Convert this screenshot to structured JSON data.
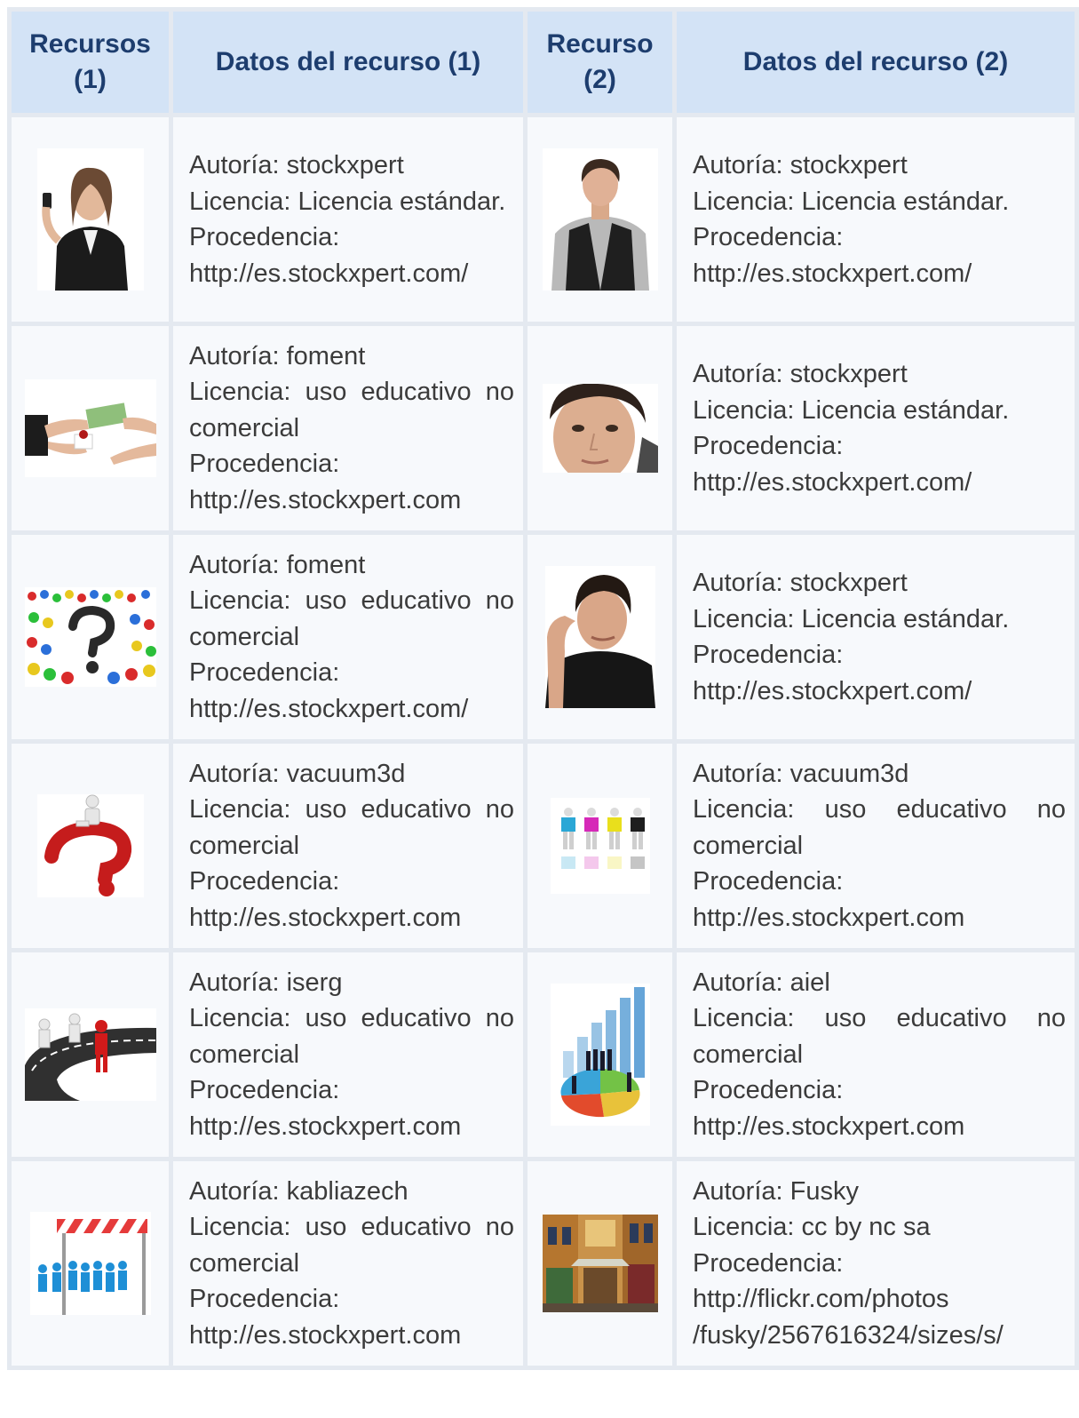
{
  "table": {
    "headers": [
      "Recursos (1)",
      "Datos del recurso (1)",
      "Recurso (2)",
      "Datos del recurso (2)"
    ],
    "rows": [
      {
        "left": {
          "image": "woman-phone-icon",
          "lines": [
            "Autoría: stockxpert",
            "Licencia: Licencia estándar.",
            "Procedencia:",
            "http://es.stockxpert.com/"
          ]
        },
        "right": {
          "image": "young-man-vest-icon",
          "lines": [
            "Autoría: stockxpert",
            "Licencia: Licencia estándar.",
            "Procedencia:",
            "http://es.stockxpert.com/"
          ]
        }
      },
      {
        "left": {
          "image": "handshake-money-icon",
          "lines": [
            "Autoría: foment",
            "Licencia: uso educativo no comercial",
            "Procedencia:",
            "http://es.stockxpert.com"
          ]
        },
        "right": {
          "image": "man-face-closeup-icon",
          "lines": [
            "Autoría: stockxpert",
            "Licencia: Licencia estándar.",
            "Procedencia:",
            "http://es.stockxpert.com/"
          ]
        }
      },
      {
        "left": {
          "image": "crowd-question-mark-icon",
          "lines": [
            "Autoría: foment",
            "Licencia: uso educativo no comercial",
            "Procedencia:",
            "http://es.stockxpert.com/"
          ]
        },
        "right": {
          "image": "man-thinking-icon",
          "lines": [
            "Autoría: stockxpert",
            "Licencia: Licencia estándar.",
            "Procedencia:",
            "http://es.stockxpert.com/"
          ]
        }
      },
      {
        "left": {
          "image": "figure-on-question-mark-icon",
          "lines": [
            "Autoría: vacuum3d",
            "Licencia: uso educativo no comercial",
            "Procedencia:",
            "http://es.stockxpert.com"
          ]
        },
        "right": {
          "image": "puzzle-figures-icon",
          "lines": [
            "Autoría: vacuum3d",
            "Licencia: uso educativo no comercial",
            "Procedencia:",
            "http://es.stockxpert.com"
          ]
        }
      },
      {
        "left": {
          "image": "race-track-figures-icon",
          "lines": [
            "Autoría: iserg",
            "Licencia: uso educativo no comercial",
            "Procedencia:",
            "http://es.stockxpert.com"
          ]
        },
        "right": {
          "image": "business-chart-icon",
          "lines": [
            "Autoría: aiel",
            "Licencia: uso educativo no comercial",
            "Procedencia:",
            "http://es.stockxpert.com"
          ]
        }
      },
      {
        "left": {
          "image": "barrier-crowd-icon",
          "lines": [
            "Autoría: kabliazech",
            "Licencia: uso educativo no comercial",
            "Procedencia:",
            "http://es.stockxpert.com"
          ]
        },
        "right": {
          "image": "street-painting-icon",
          "lines": [
            "Autoría: Fusky",
            "Licencia: cc by nc sa",
            "Procedencia:",
            "http://flickr.com/photos /fusky/2567616324/sizes/s/"
          ]
        }
      }
    ]
  },
  "colors": {
    "header_bg": "#d3e3f6",
    "header_text": "#1d3d6e",
    "cell_bg": "#f7f9fc",
    "grid": "#e4e9f0",
    "body_text": "#3b3b3b"
  }
}
